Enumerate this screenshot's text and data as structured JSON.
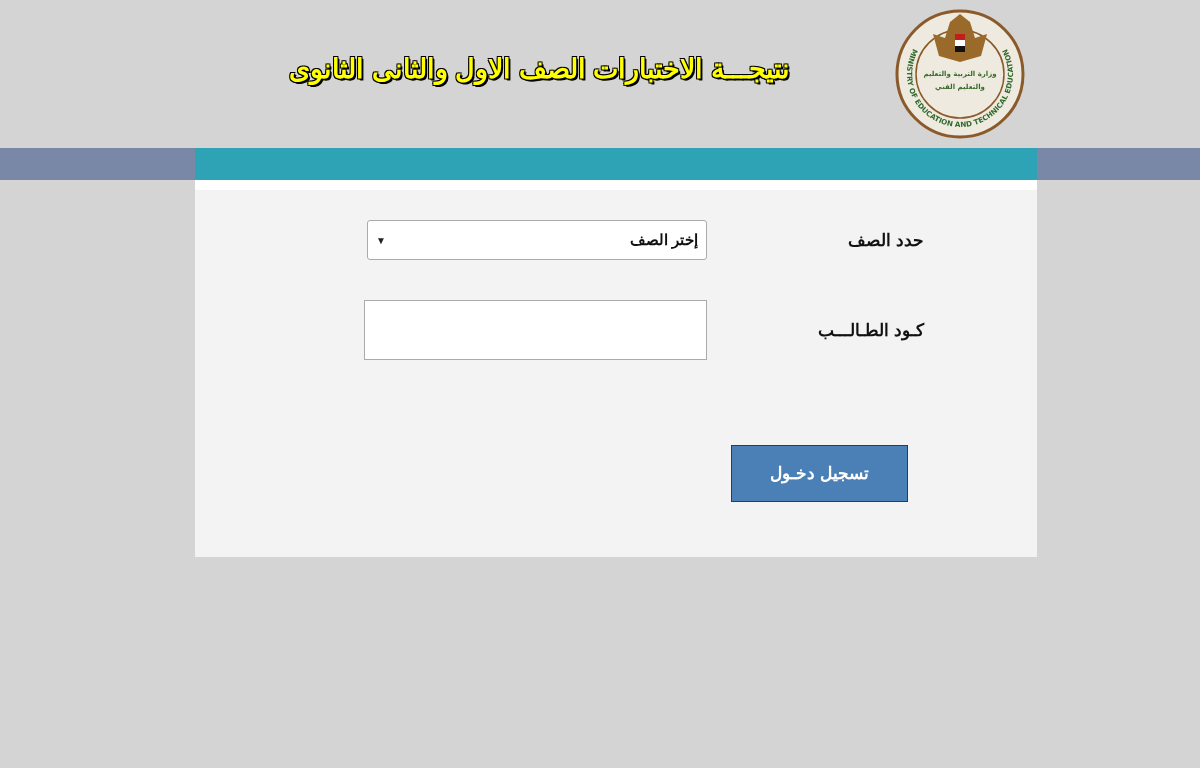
{
  "header": {
    "title": "نتيجـــة  الاختبارات الصف الاول والثانى الثانوى",
    "logo": {
      "ring_text": "MINISTRY OF EDUCATION AND TECHNICAL EDUCATION",
      "inner_lines": [
        "وزارة التربية والتعليم",
        "والتعليم الفني"
      ]
    }
  },
  "form": {
    "fields": [
      {
        "kind": "select",
        "label": "حدد الصف",
        "value": "إختر الصف",
        "arrow": "▼"
      },
      {
        "kind": "text",
        "label": "كـود الطـالـــب"
      }
    ],
    "submit": "تسجيل دخـول"
  }
}
